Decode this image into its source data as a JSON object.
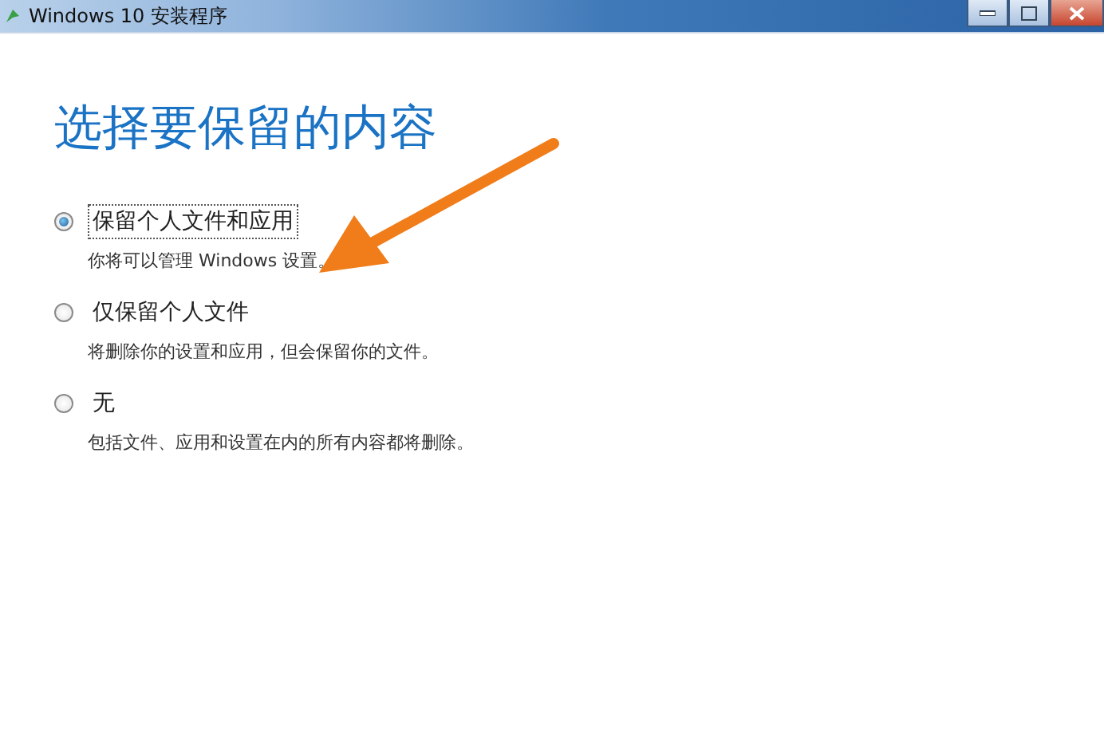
{
  "window": {
    "title": "Windows 10 安装程序"
  },
  "heading": "选择要保留的内容",
  "options": [
    {
      "label": "保留个人文件和应用",
      "description": "你将可以管理 Windows 设置。",
      "selected": true
    },
    {
      "label": "仅保留个人文件",
      "description": "将删除你的设置和应用，但会保留你的文件。",
      "selected": false
    },
    {
      "label": "无",
      "description": "包括文件、应用和设置在内的所有内容都将删除。",
      "selected": false
    }
  ]
}
